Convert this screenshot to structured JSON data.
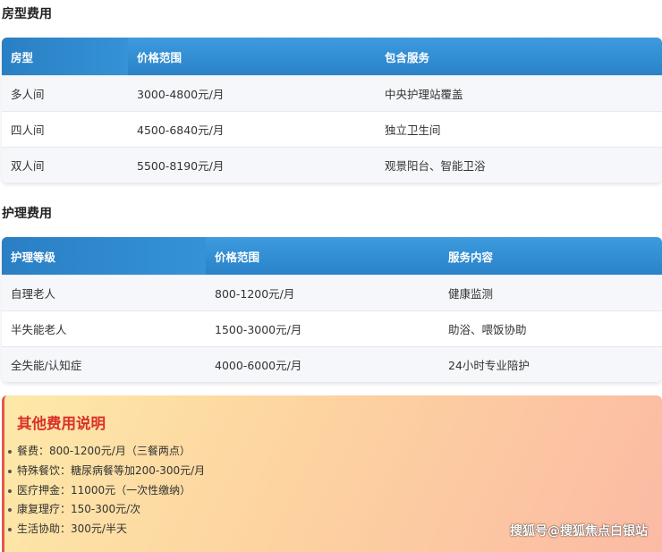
{
  "room_section": {
    "title": "房型费用",
    "headers": [
      "房型",
      "价格范围",
      "包含服务"
    ],
    "rows": [
      [
        "多人间",
        "3000-4800元/月",
        "中央护理站覆盖"
      ],
      [
        "四人间",
        "4500-6840元/月",
        "独立卫生间"
      ],
      [
        "双人间",
        "5500-8190元/月",
        "观景阳台、智能卫浴"
      ]
    ]
  },
  "care_section": {
    "title": "护理费用",
    "headers": [
      "护理等级",
      "价格范围",
      "服务内容"
    ],
    "rows": [
      [
        "自理老人",
        "800-1200元/月",
        "健康监测"
      ],
      [
        "半失能老人",
        "1500-3000元/月",
        "助浴、喂饭协助"
      ],
      [
        "全失能/认知症",
        "4000-6000元/月",
        "24小时专业陪护"
      ]
    ]
  },
  "other_fees": {
    "title": "其他费用说明",
    "items": [
      "餐费：800-1200元/月（三餐两点）",
      "特殊餐饮：糖尿病餐等加200-300元/月",
      "医疗押金：11000元（一次性缴纳）",
      "康复理疗：150-300元/次",
      "生活协助：300元/半天"
    ]
  },
  "watermark": "搜狐号@搜狐焦点白银站",
  "colors": {
    "header_blue": "#2a82c8",
    "accent_red": "#d9302a",
    "panel_gradient_start": "#fde9a9",
    "panel_gradient_end": "#fbbaa4"
  }
}
